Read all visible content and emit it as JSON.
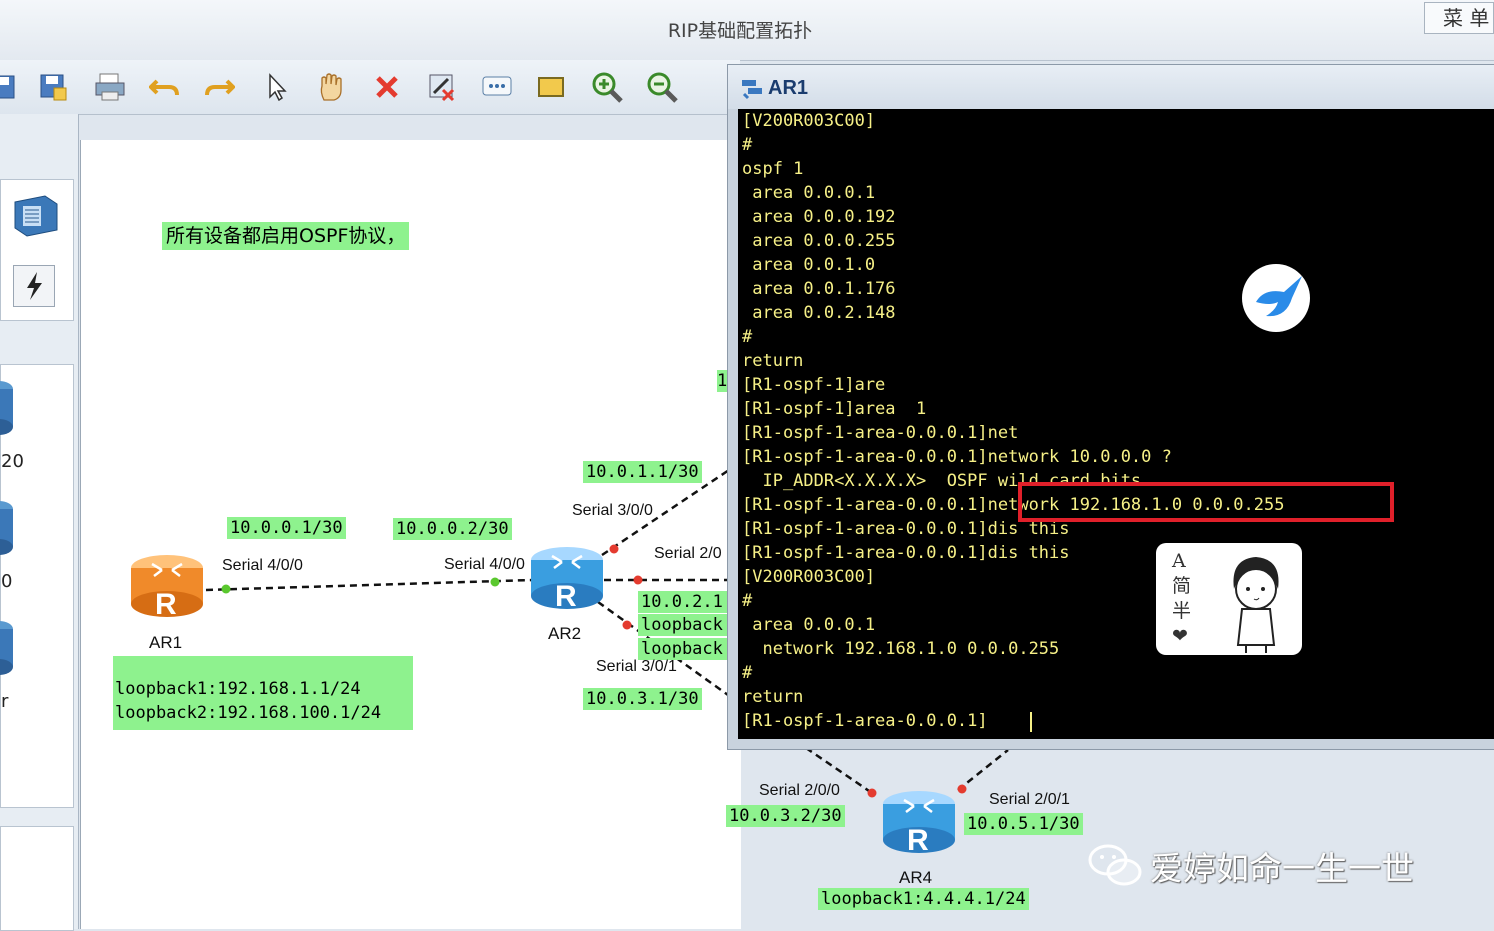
{
  "window": {
    "title": "RIP基础配置拓扑",
    "menu_label": "菜 单"
  },
  "toolbar": {
    "items": [
      {
        "name": "save-icon"
      },
      {
        "name": "save-as-icon"
      },
      {
        "name": "print-icon"
      },
      {
        "name": "undo-icon"
      },
      {
        "name": "redo-icon"
      },
      {
        "name": "pointer-icon"
      },
      {
        "name": "hand-icon"
      },
      {
        "name": "delete-icon"
      },
      {
        "name": "delete-link-icon"
      },
      {
        "name": "text-icon"
      },
      {
        "name": "rectangle-icon"
      },
      {
        "name": "zoom-in-icon"
      },
      {
        "name": "zoom-out-icon"
      }
    ]
  },
  "left_pane": {
    "device_labels": [
      "20",
      "0",
      "r"
    ]
  },
  "topology": {
    "note": "所有设备都启用OSPF协议，",
    "routers": {
      "ar1": "AR1",
      "ar2": "AR2",
      "ar4": "AR4"
    },
    "labels": {
      "ar1_ip": "10.0.0.1/30",
      "ar2_ip_s400": "10.0.0.2/30",
      "ar2_ip_s300": "10.0.1.1/30",
      "ar2_ip_s200": "10.0.2.1",
      "ar2_lb1": "loopback",
      "ar2_lb2": "loopback",
      "ar2_ip_s301": "10.0.3.1/30",
      "ar4_ip_s200": "10.0.3.2/30",
      "ar4_ip_s201": "10.0.5.1/30",
      "ar1_lb1": "loopback1:192.168.1.1/24",
      "ar1_lb2": "loopback2:192.168.100.1/24",
      "ar4_lb1": "loopback1:4.4.4.1/24",
      "top_right": "1"
    },
    "interfaces": {
      "ar1_s400": "Serial 4/0/0",
      "ar2_s400": "Serial 4/0/0",
      "ar2_s300": "Serial 3/0/0",
      "ar2_s200": "Serial 2/0",
      "ar2_s301": "Serial 3/0/1",
      "ar4_s200": "Serial 2/0/0",
      "ar4_s201": "Serial 2/0/1"
    }
  },
  "terminal": {
    "title": "AR1",
    "lines": [
      "[V200R003C00]",
      "#",
      "ospf 1",
      " area 0.0.0.1",
      " area 0.0.0.192",
      " area 0.0.0.255",
      " area 0.0.1.0",
      " area 0.0.1.176",
      " area 0.0.2.148",
      "#",
      "return",
      "[R1-ospf-1]are",
      "[R1-ospf-1]area  1",
      "[R1-ospf-1-area-0.0.0.1]net",
      "[R1-ospf-1-area-0.0.0.1]network 10.0.0.0 ?",
      "  IP_ADDR<X.X.X.X>  OSPF wild card bits",
      "[R1-ospf-1-area-0.0.0.1]network 192.168.1.0 0.0.0.255",
      "[R1-ospf-1-area-0.0.0.1]dis this",
      "[R1-ospf-1-area-0.0.0.1]dis this",
      "[V200R003C00]",
      "#",
      " area 0.0.0.1",
      "  network 192.168.1.0 0.0.0.255",
      "#",
      "return",
      "[R1-ospf-1-area-0.0.0.1]"
    ]
  },
  "sticker": {
    "text": [
      "A",
      "简",
      "半",
      "❤"
    ]
  },
  "watermark": "爱婷如命一生一世",
  "colors": {
    "label_bg": "#8ef28e",
    "terminal_text": "#f6f087",
    "highlight": "#e0202a",
    "router_ar1": "#f08a2a",
    "router_blue": "#3a9ee0"
  }
}
